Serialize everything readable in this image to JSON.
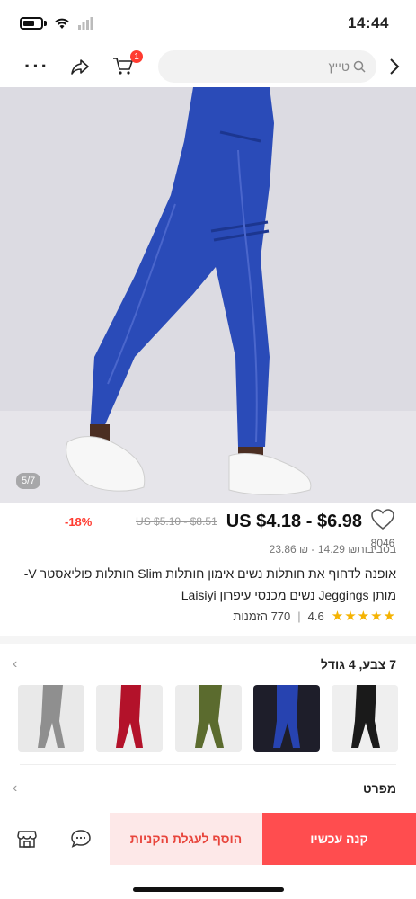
{
  "status_bar": {
    "time": "14:44"
  },
  "header": {
    "search_placeholder": "טייץ",
    "cart_count": "1"
  },
  "gallery": {
    "counter": "5/7"
  },
  "product": {
    "price_range": "US $4.18 - $6.98",
    "original_price": "US $5.10 - $8.51",
    "discount": "-18%",
    "wishlist_count": "8046",
    "approx_price": "בסביבות₪ 14.29 - ₪ 23.86",
    "title": "אופנה לדחוף את חותלות נשים אימון חותלות Slim חותלות פוליאסטר V-מותן Jeggings נשים מכנסי עיפרון Laisiyi",
    "rating": "4.6",
    "orders": "770 הזמנות",
    "stars": "★★★★★"
  },
  "variants": {
    "label": "7 צבע, 4 גודל",
    "thumbnails": [
      {
        "name": "gray",
        "color": "#8f8f8f"
      },
      {
        "name": "red",
        "color": "#b3122a"
      },
      {
        "name": "green",
        "color": "#5b6b2e"
      },
      {
        "name": "blue",
        "color": "#2743b0"
      },
      {
        "name": "black",
        "color": "#1a1a1a"
      }
    ]
  },
  "specs": {
    "label": "מפרט"
  },
  "bottom_bar": {
    "add_to_cart": "הוסף לעגלת הקניות",
    "buy_now": "קנה עכשיו"
  },
  "colors": {
    "accent": "#ff4d4f",
    "discount": "#ff3b30",
    "hero_bg": "#d9d8e0",
    "leggings": "#2a4bb8"
  }
}
